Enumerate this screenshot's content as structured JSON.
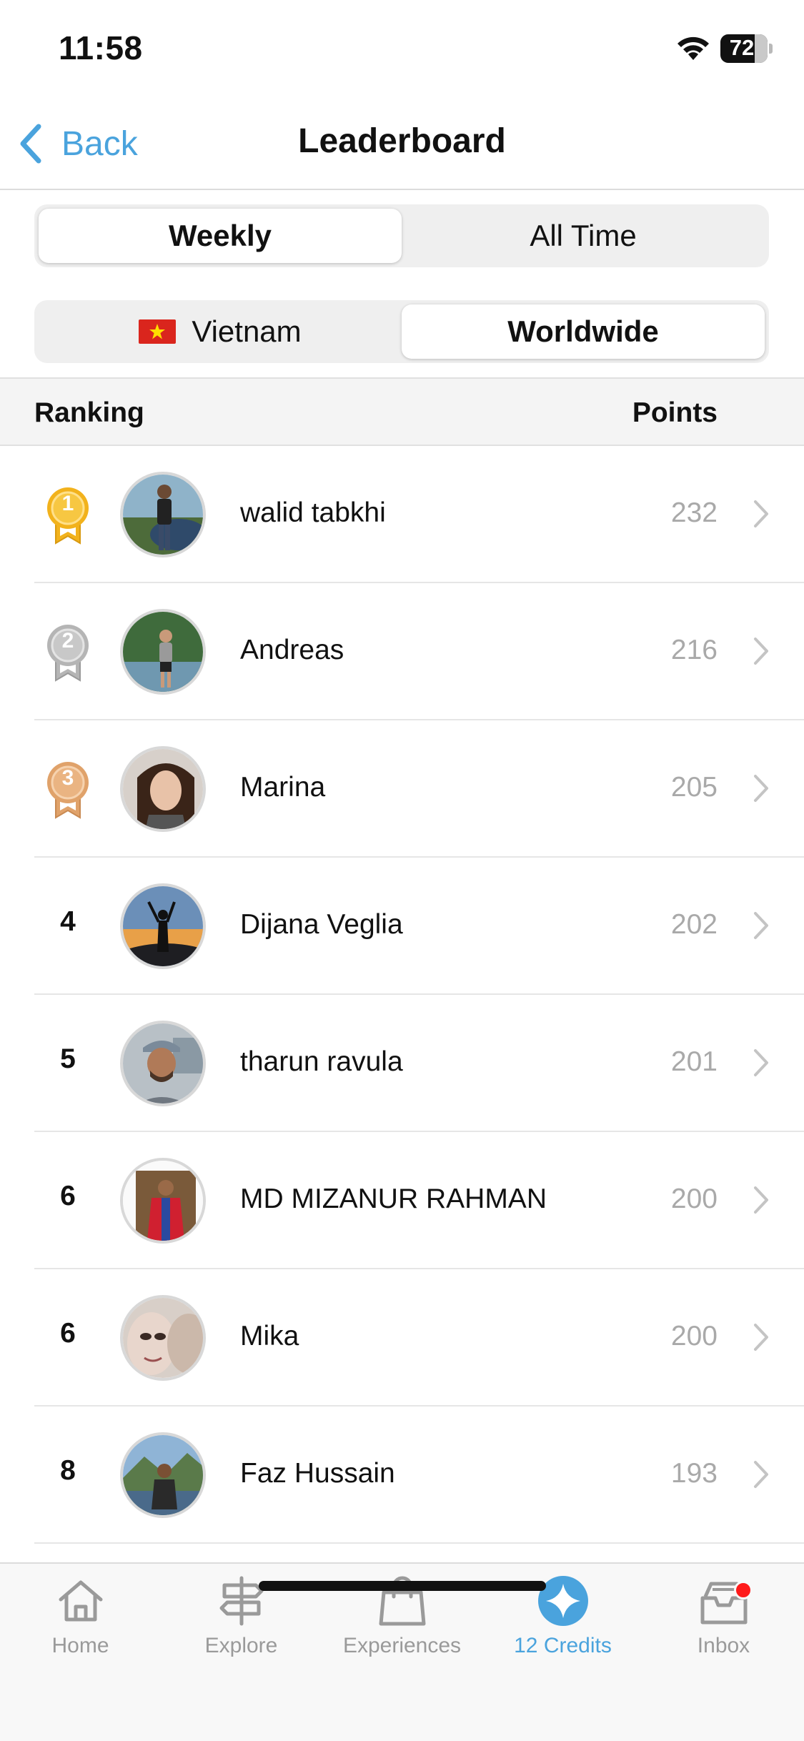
{
  "status_bar": {
    "time": "11:58",
    "battery": "72",
    "battery_level": 72
  },
  "nav": {
    "back_label": "Back",
    "title": "Leaderboard"
  },
  "period_tabs": [
    {
      "label": "Weekly",
      "selected": true
    },
    {
      "label": "All Time",
      "selected": false
    }
  ],
  "scope_tabs": [
    {
      "label": "Vietnam",
      "icon": "vietnam-flag-icon",
      "selected": false
    },
    {
      "label": "Worldwide",
      "selected": true
    }
  ],
  "table": {
    "header_ranking": "Ranking",
    "header_points": "Points",
    "rows": [
      {
        "rank": "1",
        "medal": "gold",
        "name": "walid tabkhi",
        "points": "232"
      },
      {
        "rank": "2",
        "medal": "silver",
        "name": "Andreas",
        "points": "216"
      },
      {
        "rank": "3",
        "medal": "bronze",
        "name": "Marina",
        "points": "205"
      },
      {
        "rank": "4",
        "name": "Dijana Veglia",
        "points": "202"
      },
      {
        "rank": "5",
        "name": "tharun ravula",
        "points": "201"
      },
      {
        "rank": "6",
        "name": "MD MIZANUR RAHMAN",
        "points": "200"
      },
      {
        "rank": "6",
        "name": "Mika",
        "points": "200"
      },
      {
        "rank": "8",
        "name": "Faz Hussain",
        "points": "193"
      }
    ]
  },
  "tab_bar": [
    {
      "label": "Home",
      "icon": "home-icon",
      "active": false
    },
    {
      "label": "Explore",
      "icon": "signpost-icon",
      "active": false
    },
    {
      "label": "Experiences",
      "icon": "shopping-bag-icon",
      "active": false
    },
    {
      "label": "12 Credits",
      "icon": "sparkle-star-icon",
      "active": true
    },
    {
      "label": "Inbox",
      "icon": "inbox-tray-icon",
      "active": false,
      "has_badge": true
    }
  ],
  "colors": {
    "accent": "#4aa3dd",
    "gold": "#f2b21c",
    "silver": "#b5b5b5",
    "bronze": "#e0a26a",
    "badge": "#ff1a1a"
  }
}
